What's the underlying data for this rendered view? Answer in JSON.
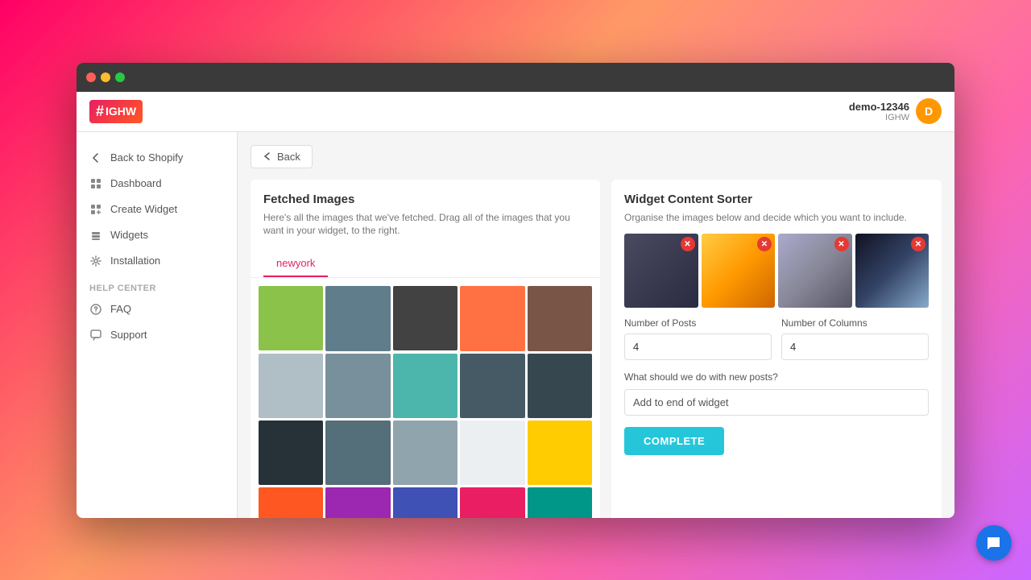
{
  "window": {
    "traffic_lights": [
      "close",
      "minimize",
      "maximize"
    ]
  },
  "header": {
    "logo_hash": "#",
    "logo_text": "IGHW",
    "user_initial": "D",
    "user_name": "demo-12346",
    "user_company": "IGHW"
  },
  "sidebar": {
    "nav_items": [
      {
        "id": "back-shopify",
        "label": "Back to Shopify",
        "icon": "arrow-left"
      },
      {
        "id": "dashboard",
        "label": "Dashboard",
        "icon": "grid"
      },
      {
        "id": "create-widget",
        "label": "Create Widget",
        "icon": "plus-grid"
      },
      {
        "id": "widgets",
        "label": "Widgets",
        "icon": "layers"
      },
      {
        "id": "installation",
        "label": "Installation",
        "icon": "settings"
      }
    ],
    "help_label": "HELP CENTER",
    "help_items": [
      {
        "id": "faq",
        "label": "FAQ",
        "icon": "question"
      },
      {
        "id": "support",
        "label": "Support",
        "icon": "chat"
      }
    ]
  },
  "content": {
    "back_button": "Back",
    "left_panel": {
      "title": "Fetched Images",
      "description": "Here's all the images that we've fetched. Drag all of the images that you want in your widget, to the right.",
      "tab": "newyork"
    },
    "right_panel": {
      "title": "Widget Content Sorter",
      "description": "Organise the images below and decide which you want to include.",
      "number_of_posts_label": "Number of Posts",
      "number_of_posts_value": "4",
      "number_of_columns_label": "Number of Columns",
      "number_of_columns_value": "4",
      "new_posts_label": "What should we do with new posts?",
      "new_posts_value": "Add to end of widget",
      "complete_button": "COMPLETE"
    }
  }
}
